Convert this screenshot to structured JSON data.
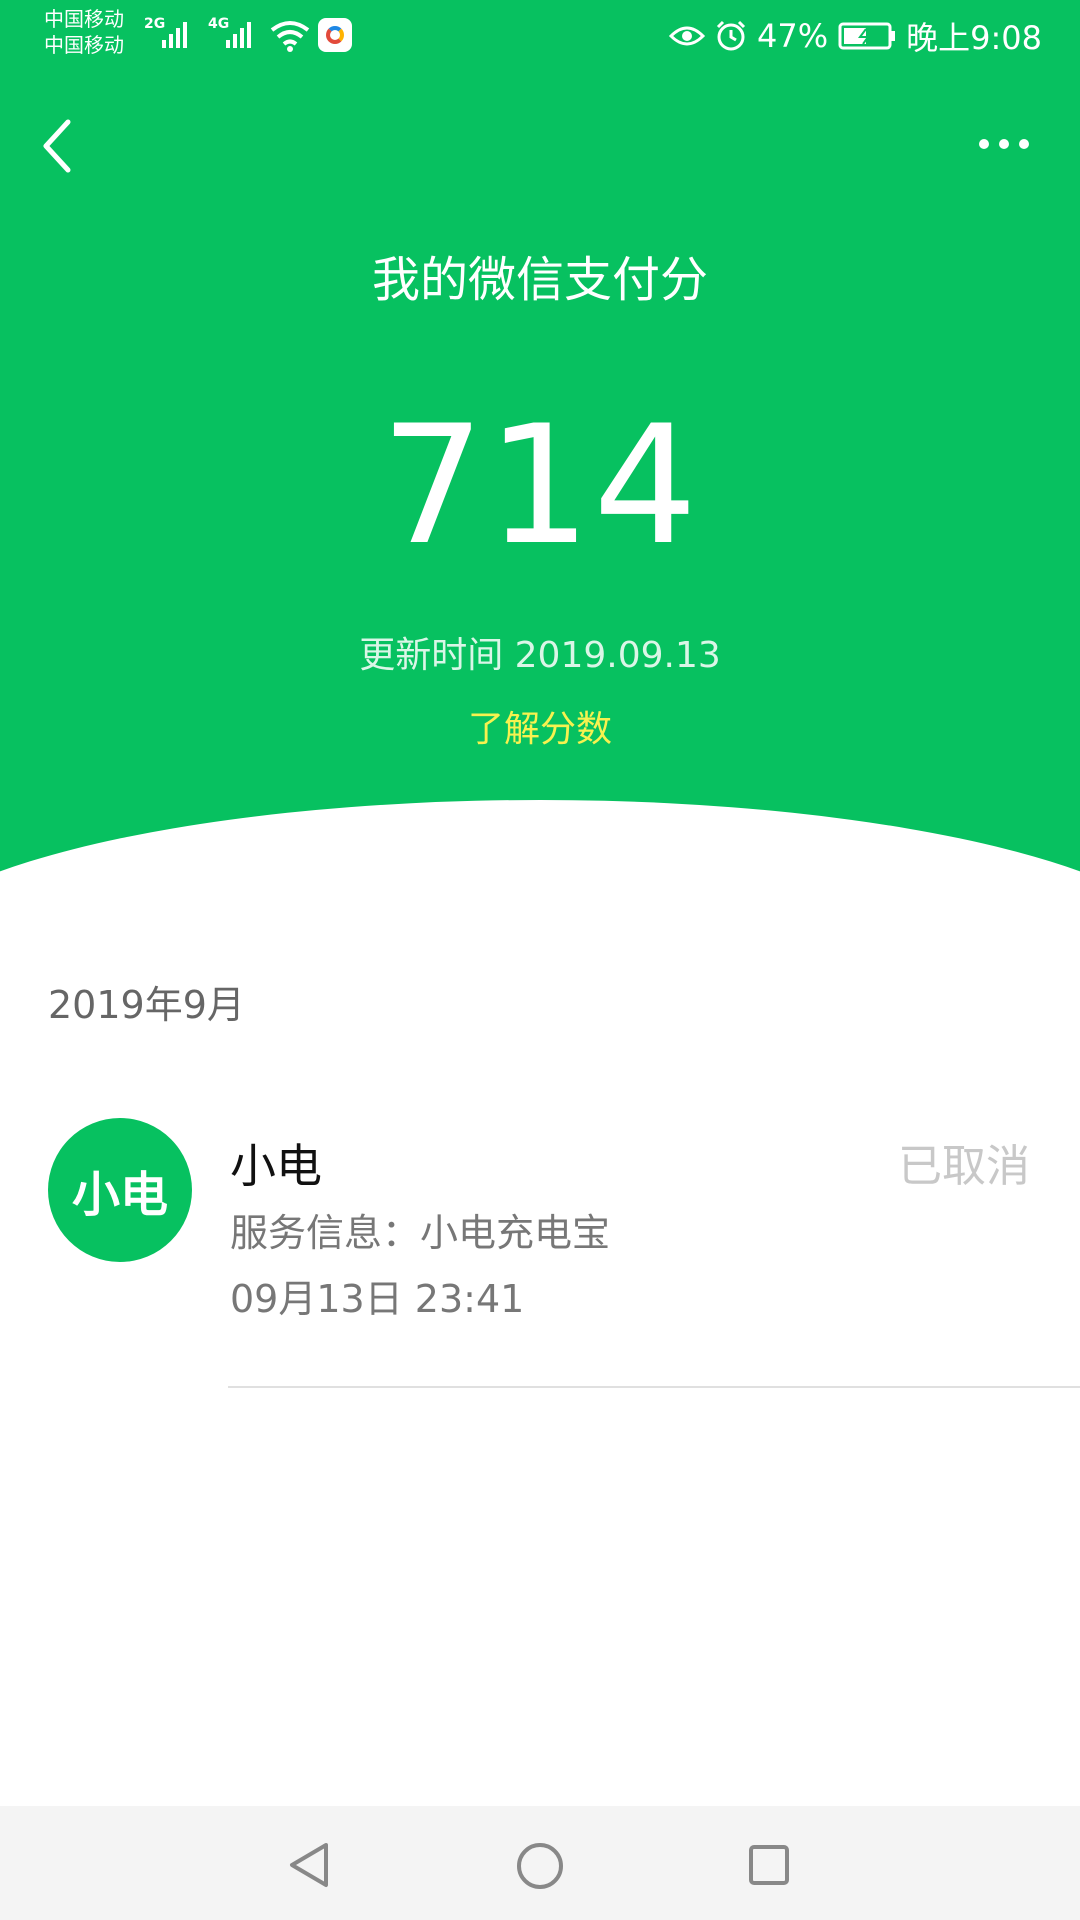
{
  "status_bar": {
    "carrier_1": "中国移动",
    "carrier_2": "中国移动",
    "net_1": "2G",
    "net_2": "4G",
    "battery": "47%",
    "time": "晚上9:08",
    "icons": [
      "signal-icon",
      "wifi-icon",
      "app-icon",
      "eye-icon",
      "alarm-icon",
      "battery-icon"
    ]
  },
  "header": {
    "title": "我的微信支付分",
    "score": "714",
    "update_time": "更新时间 2019.09.13",
    "learn_link": "了解分数"
  },
  "content": {
    "month": "2019年9月",
    "records": [
      {
        "avatar_text": "小电",
        "name": "小电",
        "status": "已取消",
        "service": "服务信息：小电充电宝",
        "time": "09月13日 23:41"
      }
    ]
  },
  "colors": {
    "brand_green": "#07c160",
    "link_yellow": "#f7f24f",
    "muted_gray": "#c8c8c8"
  },
  "nav_icons": [
    "nav-back-icon",
    "nav-home-icon",
    "nav-recent-icon"
  ]
}
